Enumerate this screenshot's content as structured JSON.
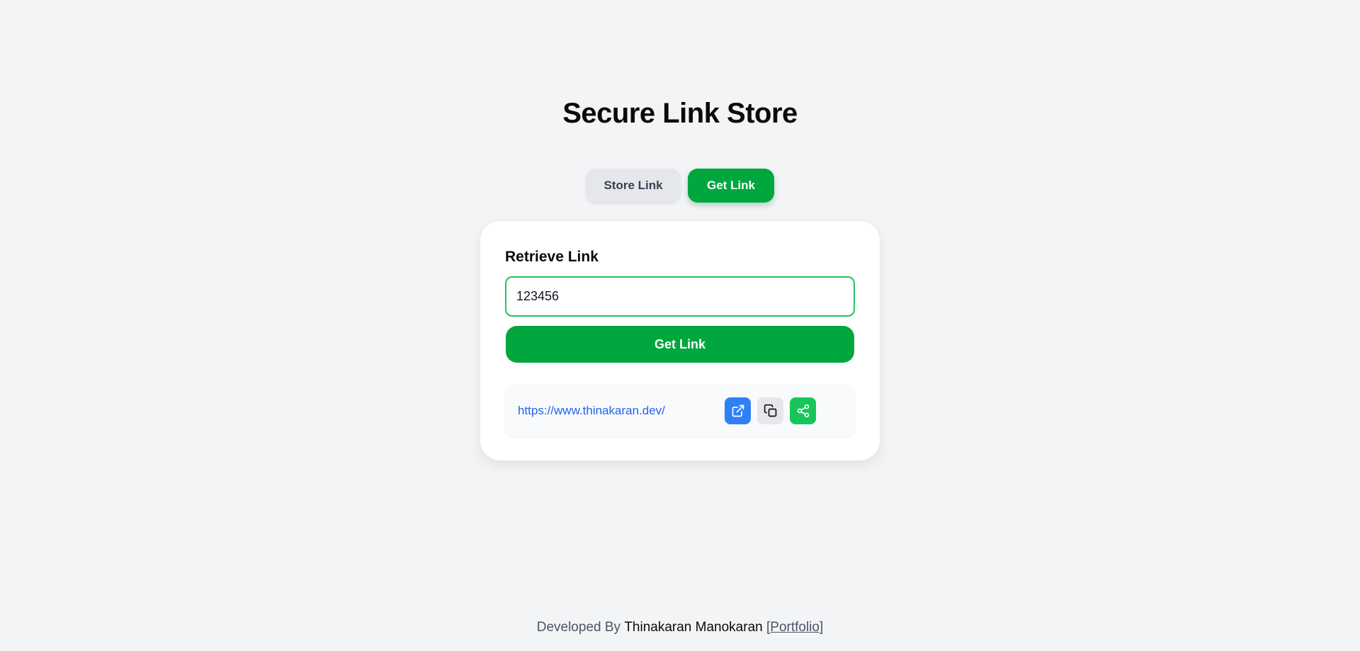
{
  "page": {
    "title": "Secure Link Store"
  },
  "tabs": [
    {
      "label": "Store Link",
      "active": false
    },
    {
      "label": "Get Link",
      "active": true
    }
  ],
  "card": {
    "heading": "Retrieve Link",
    "code_input_value": "123456",
    "submit_label": "Get Link"
  },
  "result": {
    "url": "https://www.thinakaran.dev/",
    "actions": [
      {
        "icon": "external-link-icon",
        "color": "#2f80f5"
      },
      {
        "icon": "copy-icon",
        "color": "#e5e7eb"
      },
      {
        "icon": "share-icon",
        "color": "#16c65a"
      }
    ]
  },
  "footer": {
    "prefix": "Developed By",
    "author": "Thinakaran Manokaran",
    "bracket_open": "[",
    "link_label": "Portfolio",
    "bracket_close": "]"
  },
  "colors": {
    "accent": "#00a63e",
    "background": "#f3f4f6",
    "link": "#2563eb"
  }
}
